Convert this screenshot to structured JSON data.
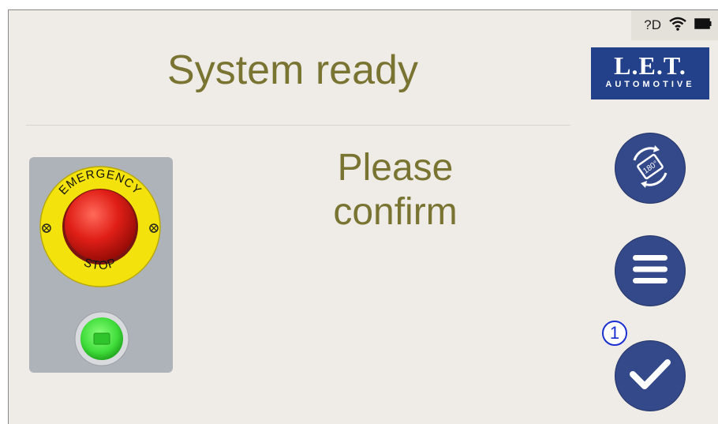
{
  "status_bar": {
    "signal_text": "?D",
    "wifi_icon": "wifi-icon",
    "battery_icon": "battery-icon"
  },
  "header": {
    "title": "System ready"
  },
  "logo": {
    "brand": "L.E.T.",
    "sub": "AUTOMOTIVE"
  },
  "main": {
    "message_line1": "Please",
    "message_line2": "confirm"
  },
  "emergency_stop": {
    "top_label": "EMERGENCY",
    "bottom_label": "STOP"
  },
  "controls": {
    "rotate": {
      "icon": "rotate-180-icon",
      "label": "180°"
    },
    "menu": {
      "icon": "menu-icon"
    },
    "confirm": {
      "icon": "checkmark-icon",
      "badge": "1"
    }
  },
  "colors": {
    "title_olive": "#7a7433",
    "button_blue": "#33498a",
    "logo_blue": "#23408a",
    "panel_grey": "#aeb3ba",
    "estop_red": "#e01f17",
    "estop_yellow": "#f4e20c",
    "go_green": "#4fe04a",
    "badge_blue": "#1a2fcf"
  }
}
